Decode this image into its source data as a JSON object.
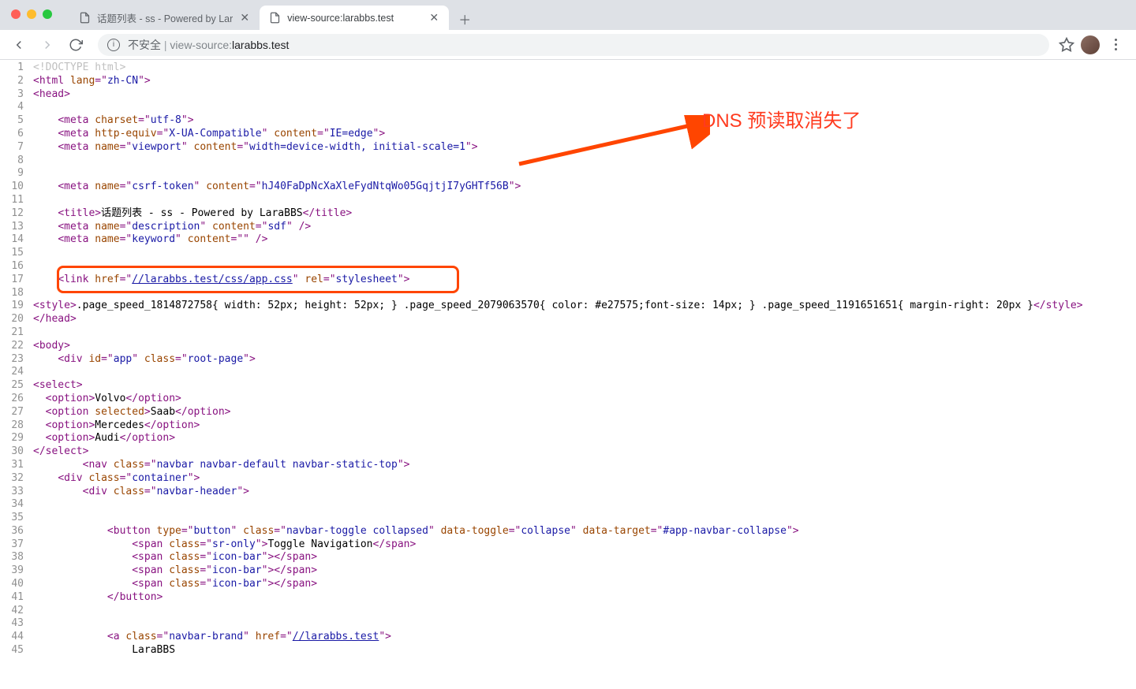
{
  "tabs": [
    {
      "title": "话题列表 - ss - Powered by Lar",
      "active": false
    },
    {
      "title": "view-source:larabbs.test",
      "active": true
    }
  ],
  "omnibox": {
    "insecure_label": "不安全",
    "url_prefix": "view-source:",
    "url_host": "larabbs.test"
  },
  "annotation": {
    "text": "DNS 预读取消失了"
  },
  "source_lines": [
    {
      "n": 1,
      "segs": [
        {
          "c": "c-doctype",
          "t": "<!DOCTYPE html>"
        }
      ]
    },
    {
      "n": 2,
      "segs": [
        {
          "c": "c-tag",
          "t": "<html "
        },
        {
          "c": "c-attr-name",
          "t": "lang"
        },
        {
          "c": "c-tag",
          "t": "=\""
        },
        {
          "c": "c-attr-val",
          "t": "zh-CN"
        },
        {
          "c": "c-tag",
          "t": "\">"
        }
      ]
    },
    {
      "n": 3,
      "segs": [
        {
          "c": "c-tag",
          "t": "<head>"
        }
      ]
    },
    {
      "n": 4,
      "segs": [
        {
          "c": "c-text",
          "t": ""
        }
      ]
    },
    {
      "n": 5,
      "segs": [
        {
          "c": "c-text",
          "t": "    "
        },
        {
          "c": "c-tag",
          "t": "<meta "
        },
        {
          "c": "c-attr-name",
          "t": "charset"
        },
        {
          "c": "c-tag",
          "t": "=\""
        },
        {
          "c": "c-attr-val",
          "t": "utf-8"
        },
        {
          "c": "c-tag",
          "t": "\">"
        }
      ]
    },
    {
      "n": 6,
      "segs": [
        {
          "c": "c-text",
          "t": "    "
        },
        {
          "c": "c-tag",
          "t": "<meta "
        },
        {
          "c": "c-attr-name",
          "t": "http-equiv"
        },
        {
          "c": "c-tag",
          "t": "=\""
        },
        {
          "c": "c-attr-val",
          "t": "X-UA-Compatible"
        },
        {
          "c": "c-tag",
          "t": "\" "
        },
        {
          "c": "c-attr-name",
          "t": "content"
        },
        {
          "c": "c-tag",
          "t": "=\""
        },
        {
          "c": "c-attr-val",
          "t": "IE=edge"
        },
        {
          "c": "c-tag",
          "t": "\">"
        }
      ]
    },
    {
      "n": 7,
      "segs": [
        {
          "c": "c-text",
          "t": "    "
        },
        {
          "c": "c-tag",
          "t": "<meta "
        },
        {
          "c": "c-attr-name",
          "t": "name"
        },
        {
          "c": "c-tag",
          "t": "=\""
        },
        {
          "c": "c-attr-val",
          "t": "viewport"
        },
        {
          "c": "c-tag",
          "t": "\" "
        },
        {
          "c": "c-attr-name",
          "t": "content"
        },
        {
          "c": "c-tag",
          "t": "=\""
        },
        {
          "c": "c-attr-val",
          "t": "width=device-width, initial-scale=1"
        },
        {
          "c": "c-tag",
          "t": "\">"
        }
      ]
    },
    {
      "n": 8,
      "segs": [
        {
          "c": "c-text",
          "t": ""
        }
      ]
    },
    {
      "n": 9,
      "segs": [
        {
          "c": "c-text",
          "t": ""
        }
      ]
    },
    {
      "n": 10,
      "segs": [
        {
          "c": "c-text",
          "t": "    "
        },
        {
          "c": "c-tag",
          "t": "<meta "
        },
        {
          "c": "c-attr-name",
          "t": "name"
        },
        {
          "c": "c-tag",
          "t": "=\""
        },
        {
          "c": "c-attr-val",
          "t": "csrf-token"
        },
        {
          "c": "c-tag",
          "t": "\" "
        },
        {
          "c": "c-attr-name",
          "t": "content"
        },
        {
          "c": "c-tag",
          "t": "=\""
        },
        {
          "c": "c-attr-val",
          "t": "hJ40FaDpNcXaXleFydNtqWo05GqjtjI7yGHTf56B"
        },
        {
          "c": "c-tag",
          "t": "\">"
        }
      ]
    },
    {
      "n": 11,
      "segs": [
        {
          "c": "c-text",
          "t": ""
        }
      ]
    },
    {
      "n": 12,
      "segs": [
        {
          "c": "c-text",
          "t": "    "
        },
        {
          "c": "c-tag",
          "t": "<title>"
        },
        {
          "c": "c-text",
          "t": "话题列表 - ss - Powered by LaraBBS"
        },
        {
          "c": "c-tag",
          "t": "</title>"
        }
      ]
    },
    {
      "n": 13,
      "segs": [
        {
          "c": "c-text",
          "t": "    "
        },
        {
          "c": "c-tag",
          "t": "<meta "
        },
        {
          "c": "c-attr-name",
          "t": "name"
        },
        {
          "c": "c-tag",
          "t": "=\""
        },
        {
          "c": "c-attr-val",
          "t": "description"
        },
        {
          "c": "c-tag",
          "t": "\" "
        },
        {
          "c": "c-attr-name",
          "t": "content"
        },
        {
          "c": "c-tag",
          "t": "=\""
        },
        {
          "c": "c-attr-val",
          "t": "sdf"
        },
        {
          "c": "c-tag",
          "t": "\" />"
        }
      ]
    },
    {
      "n": 14,
      "segs": [
        {
          "c": "c-text",
          "t": "    "
        },
        {
          "c": "c-tag",
          "t": "<meta "
        },
        {
          "c": "c-attr-name",
          "t": "name"
        },
        {
          "c": "c-tag",
          "t": "=\""
        },
        {
          "c": "c-attr-val",
          "t": "keyword"
        },
        {
          "c": "c-tag",
          "t": "\" "
        },
        {
          "c": "c-attr-name",
          "t": "content"
        },
        {
          "c": "c-tag",
          "t": "=\""
        },
        {
          "c": "c-attr-val",
          "t": ""
        },
        {
          "c": "c-tag",
          "t": "\" />"
        }
      ]
    },
    {
      "n": 15,
      "segs": [
        {
          "c": "c-text",
          "t": ""
        }
      ]
    },
    {
      "n": 16,
      "segs": [
        {
          "c": "c-text",
          "t": ""
        }
      ]
    },
    {
      "n": 17,
      "segs": [
        {
          "c": "c-text",
          "t": "    "
        },
        {
          "c": "c-tag",
          "t": "<link "
        },
        {
          "c": "c-attr-name",
          "t": "href"
        },
        {
          "c": "c-tag",
          "t": "=\""
        },
        {
          "c": "c-link",
          "t": "//larabbs.test/css/app.css"
        },
        {
          "c": "c-tag",
          "t": "\" "
        },
        {
          "c": "c-attr-name",
          "t": "rel"
        },
        {
          "c": "c-tag",
          "t": "=\""
        },
        {
          "c": "c-attr-val",
          "t": "stylesheet"
        },
        {
          "c": "c-tag",
          "t": "\">"
        }
      ]
    },
    {
      "n": 18,
      "segs": [
        {
          "c": "c-text",
          "t": ""
        }
      ]
    },
    {
      "n": 19,
      "segs": [
        {
          "c": "c-tag",
          "t": "<style>"
        },
        {
          "c": "c-text",
          "t": ".page_speed_1814872758{ width: 52px; height: 52px; } .page_speed_2079063570{ color: #e27575;font-size: 14px; } .page_speed_1191651651{ margin-right: 20px }"
        },
        {
          "c": "c-tag",
          "t": "</style>"
        }
      ]
    },
    {
      "n": 20,
      "segs": [
        {
          "c": "c-tag",
          "t": "</head>"
        }
      ]
    },
    {
      "n": 21,
      "segs": [
        {
          "c": "c-text",
          "t": ""
        }
      ]
    },
    {
      "n": 22,
      "segs": [
        {
          "c": "c-tag",
          "t": "<body>"
        }
      ]
    },
    {
      "n": 23,
      "segs": [
        {
          "c": "c-text",
          "t": "    "
        },
        {
          "c": "c-tag",
          "t": "<div "
        },
        {
          "c": "c-attr-name",
          "t": "id"
        },
        {
          "c": "c-tag",
          "t": "=\""
        },
        {
          "c": "c-attr-val",
          "t": "app"
        },
        {
          "c": "c-tag",
          "t": "\" "
        },
        {
          "c": "c-attr-name",
          "t": "class"
        },
        {
          "c": "c-tag",
          "t": "=\""
        },
        {
          "c": "c-attr-val",
          "t": "root-page"
        },
        {
          "c": "c-tag",
          "t": "\">"
        }
      ]
    },
    {
      "n": 24,
      "segs": [
        {
          "c": "c-text",
          "t": ""
        }
      ]
    },
    {
      "n": 25,
      "segs": [
        {
          "c": "c-tag",
          "t": "<select>"
        }
      ]
    },
    {
      "n": 26,
      "segs": [
        {
          "c": "c-text",
          "t": "  "
        },
        {
          "c": "c-tag",
          "t": "<option>"
        },
        {
          "c": "c-text",
          "t": "Volvo"
        },
        {
          "c": "c-tag",
          "t": "</option>"
        }
      ]
    },
    {
      "n": 27,
      "segs": [
        {
          "c": "c-text",
          "t": "  "
        },
        {
          "c": "c-tag",
          "t": "<option "
        },
        {
          "c": "c-attr-name",
          "t": "selected"
        },
        {
          "c": "c-tag",
          "t": ">"
        },
        {
          "c": "c-text",
          "t": "Saab"
        },
        {
          "c": "c-tag",
          "t": "</option>"
        }
      ]
    },
    {
      "n": 28,
      "segs": [
        {
          "c": "c-text",
          "t": "  "
        },
        {
          "c": "c-tag",
          "t": "<option>"
        },
        {
          "c": "c-text",
          "t": "Mercedes"
        },
        {
          "c": "c-tag",
          "t": "</option>"
        }
      ]
    },
    {
      "n": 29,
      "segs": [
        {
          "c": "c-text",
          "t": "  "
        },
        {
          "c": "c-tag",
          "t": "<option>"
        },
        {
          "c": "c-text",
          "t": "Audi"
        },
        {
          "c": "c-tag",
          "t": "</option>"
        }
      ]
    },
    {
      "n": 30,
      "segs": [
        {
          "c": "c-tag",
          "t": "</select>"
        }
      ]
    },
    {
      "n": 31,
      "segs": [
        {
          "c": "c-text",
          "t": "        "
        },
        {
          "c": "c-tag",
          "t": "<nav "
        },
        {
          "c": "c-attr-name",
          "t": "class"
        },
        {
          "c": "c-tag",
          "t": "=\""
        },
        {
          "c": "c-attr-val",
          "t": "navbar navbar-default navbar-static-top"
        },
        {
          "c": "c-tag",
          "t": "\">"
        }
      ]
    },
    {
      "n": 32,
      "segs": [
        {
          "c": "c-text",
          "t": "    "
        },
        {
          "c": "c-tag",
          "t": "<div "
        },
        {
          "c": "c-attr-name",
          "t": "class"
        },
        {
          "c": "c-tag",
          "t": "=\""
        },
        {
          "c": "c-attr-val",
          "t": "container"
        },
        {
          "c": "c-tag",
          "t": "\">"
        }
      ]
    },
    {
      "n": 33,
      "segs": [
        {
          "c": "c-text",
          "t": "        "
        },
        {
          "c": "c-tag",
          "t": "<div "
        },
        {
          "c": "c-attr-name",
          "t": "class"
        },
        {
          "c": "c-tag",
          "t": "=\""
        },
        {
          "c": "c-attr-val",
          "t": "navbar-header"
        },
        {
          "c": "c-tag",
          "t": "\">"
        }
      ]
    },
    {
      "n": 34,
      "segs": [
        {
          "c": "c-text",
          "t": ""
        }
      ]
    },
    {
      "n": 35,
      "segs": [
        {
          "c": "c-text",
          "t": ""
        }
      ]
    },
    {
      "n": 36,
      "segs": [
        {
          "c": "c-text",
          "t": "            "
        },
        {
          "c": "c-tag",
          "t": "<button "
        },
        {
          "c": "c-attr-name",
          "t": "type"
        },
        {
          "c": "c-tag",
          "t": "=\""
        },
        {
          "c": "c-attr-val",
          "t": "button"
        },
        {
          "c": "c-tag",
          "t": "\" "
        },
        {
          "c": "c-attr-name",
          "t": "class"
        },
        {
          "c": "c-tag",
          "t": "=\""
        },
        {
          "c": "c-attr-val",
          "t": "navbar-toggle collapsed"
        },
        {
          "c": "c-tag",
          "t": "\" "
        },
        {
          "c": "c-attr-name",
          "t": "data-toggle"
        },
        {
          "c": "c-tag",
          "t": "=\""
        },
        {
          "c": "c-attr-val",
          "t": "collapse"
        },
        {
          "c": "c-tag",
          "t": "\" "
        },
        {
          "c": "c-attr-name",
          "t": "data-target"
        },
        {
          "c": "c-tag",
          "t": "=\""
        },
        {
          "c": "c-attr-val",
          "t": "#app-navbar-collapse"
        },
        {
          "c": "c-tag",
          "t": "\">"
        }
      ]
    },
    {
      "n": 37,
      "segs": [
        {
          "c": "c-text",
          "t": "                "
        },
        {
          "c": "c-tag",
          "t": "<span "
        },
        {
          "c": "c-attr-name",
          "t": "class"
        },
        {
          "c": "c-tag",
          "t": "=\""
        },
        {
          "c": "c-attr-val",
          "t": "sr-only"
        },
        {
          "c": "c-tag",
          "t": "\">"
        },
        {
          "c": "c-text",
          "t": "Toggle Navigation"
        },
        {
          "c": "c-tag",
          "t": "</span>"
        }
      ]
    },
    {
      "n": 38,
      "segs": [
        {
          "c": "c-text",
          "t": "                "
        },
        {
          "c": "c-tag",
          "t": "<span "
        },
        {
          "c": "c-attr-name",
          "t": "class"
        },
        {
          "c": "c-tag",
          "t": "=\""
        },
        {
          "c": "c-attr-val",
          "t": "icon-bar"
        },
        {
          "c": "c-tag",
          "t": "\"></span>"
        }
      ]
    },
    {
      "n": 39,
      "segs": [
        {
          "c": "c-text",
          "t": "                "
        },
        {
          "c": "c-tag",
          "t": "<span "
        },
        {
          "c": "c-attr-name",
          "t": "class"
        },
        {
          "c": "c-tag",
          "t": "=\""
        },
        {
          "c": "c-attr-val",
          "t": "icon-bar"
        },
        {
          "c": "c-tag",
          "t": "\"></span>"
        }
      ]
    },
    {
      "n": 40,
      "segs": [
        {
          "c": "c-text",
          "t": "                "
        },
        {
          "c": "c-tag",
          "t": "<span "
        },
        {
          "c": "c-attr-name",
          "t": "class"
        },
        {
          "c": "c-tag",
          "t": "=\""
        },
        {
          "c": "c-attr-val",
          "t": "icon-bar"
        },
        {
          "c": "c-tag",
          "t": "\"></span>"
        }
      ]
    },
    {
      "n": 41,
      "segs": [
        {
          "c": "c-text",
          "t": "            "
        },
        {
          "c": "c-tag",
          "t": "</button>"
        }
      ]
    },
    {
      "n": 42,
      "segs": [
        {
          "c": "c-text",
          "t": ""
        }
      ]
    },
    {
      "n": 43,
      "segs": [
        {
          "c": "c-text",
          "t": ""
        }
      ]
    },
    {
      "n": 44,
      "segs": [
        {
          "c": "c-text",
          "t": "            "
        },
        {
          "c": "c-tag",
          "t": "<a "
        },
        {
          "c": "c-attr-name",
          "t": "class"
        },
        {
          "c": "c-tag",
          "t": "=\""
        },
        {
          "c": "c-attr-val",
          "t": "navbar-brand"
        },
        {
          "c": "c-tag",
          "t": "\" "
        },
        {
          "c": "c-attr-name",
          "t": "href"
        },
        {
          "c": "c-tag",
          "t": "=\""
        },
        {
          "c": "c-link",
          "t": "//larabbs.test"
        },
        {
          "c": "c-tag",
          "t": "\">"
        }
      ]
    },
    {
      "n": 45,
      "segs": [
        {
          "c": "c-text",
          "t": "                LaraBBS"
        }
      ]
    }
  ]
}
